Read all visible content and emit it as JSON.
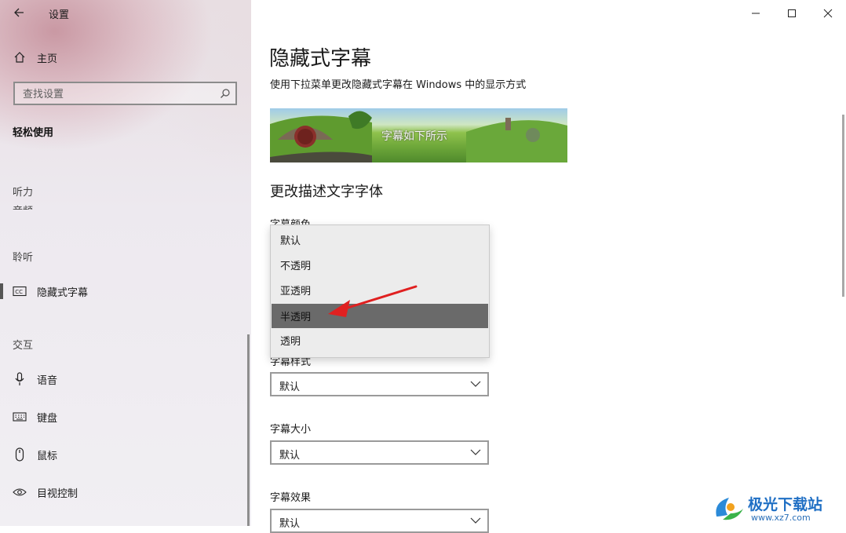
{
  "window": {
    "title": "设置"
  },
  "sidebar": {
    "home": "主页",
    "search_placeholder": "查找设置",
    "category": "轻松使用",
    "groups": {
      "hearing": "听力",
      "hearing_partial": "音频",
      "listening": "聆听",
      "interaction": "交互"
    },
    "items": {
      "captions": "隐藏式字幕",
      "speech": "语音",
      "keyboard": "键盘",
      "mouse": "鼠标",
      "eye_control": "目视控制"
    }
  },
  "main": {
    "title": "隐藏式字幕",
    "description": "使用下拉菜单更改隐藏式字幕在 Windows 中的显示方式",
    "preview_caption": "字幕如下所示",
    "section_title": "更改描述文字字体",
    "fields": {
      "caption_color": {
        "label": "字幕颜色"
      },
      "caption_style": {
        "label": "字幕样式",
        "value": "默认"
      },
      "caption_size": {
        "label": "字幕大小",
        "value": "默认"
      },
      "caption_effects": {
        "label": "字幕效果",
        "value": "默认"
      }
    }
  },
  "dropdown": {
    "options": [
      "默认",
      "不透明",
      "亚透明",
      "半透明",
      "透明"
    ],
    "highlighted": "半透明"
  },
  "annotation": {
    "arrow_color": "#e02020"
  },
  "watermark": {
    "name": "极光下载站",
    "url": "www.xz7.com"
  }
}
